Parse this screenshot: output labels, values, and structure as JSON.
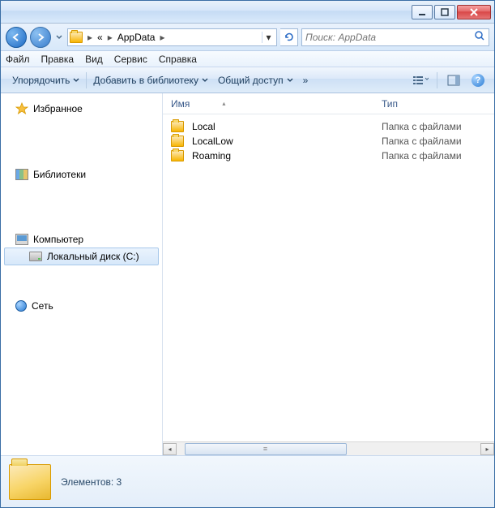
{
  "titlebar": {},
  "nav": {
    "breadcrumb_prefix": "«",
    "breadcrumb_current": "AppData",
    "search_placeholder": "Поиск: AppData"
  },
  "menubar": {
    "file": "Файл",
    "edit": "Правка",
    "view": "Вид",
    "tools": "Сервис",
    "help": "Справка"
  },
  "toolbar": {
    "organize": "Упорядочить",
    "add_library": "Добавить в библиотеку",
    "share": "Общий доступ",
    "overflow": "»"
  },
  "sidebar": {
    "favorites": "Избранное",
    "libraries": "Библиотеки",
    "computer": "Компьютер",
    "local_disk": "Локальный диск (C:)",
    "network": "Сеть"
  },
  "columns": {
    "name": "Имя",
    "type": "Тип"
  },
  "rows": [
    {
      "name": "Local",
      "type": "Папка с файлами"
    },
    {
      "name": "LocalLow",
      "type": "Папка с файлами"
    },
    {
      "name": "Roaming",
      "type": "Папка с файлами"
    }
  ],
  "status": {
    "label": "Элементов: 3"
  }
}
